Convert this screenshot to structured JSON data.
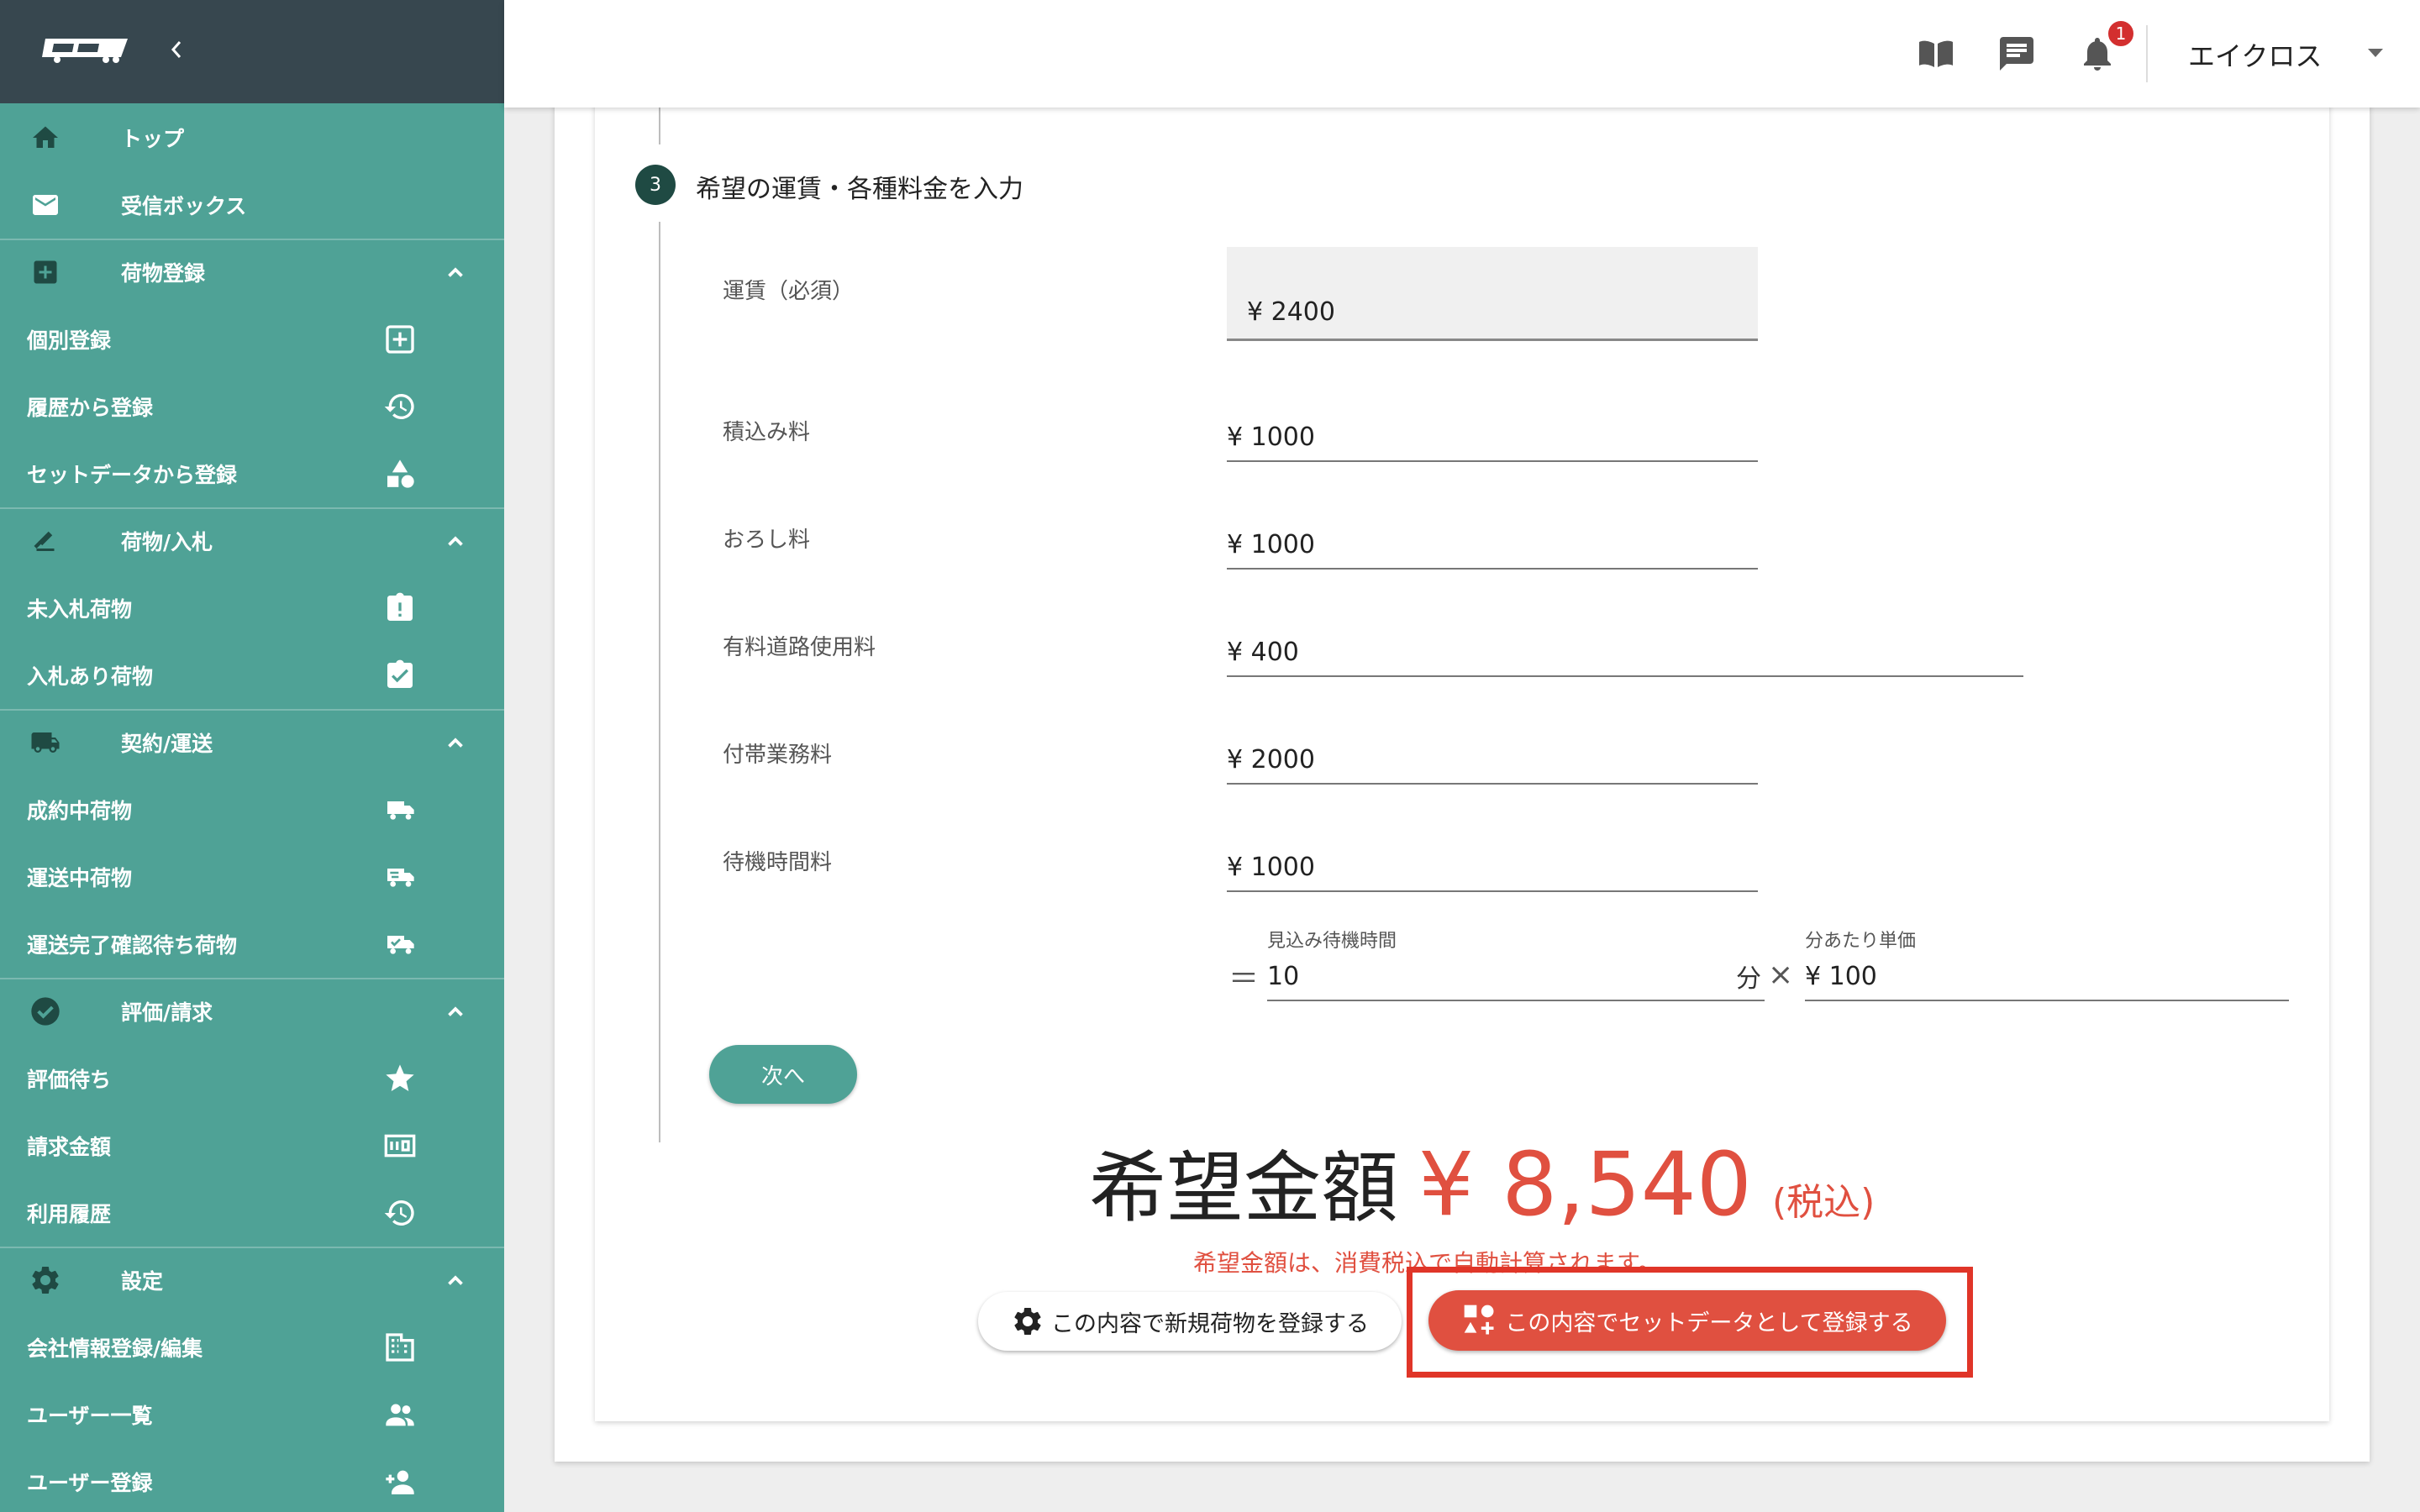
{
  "sidebar": {
    "items": [
      {
        "label": "トップ",
        "icon": "home-icon"
      },
      {
        "label": "受信ボックス",
        "icon": "mail-icon"
      },
      {
        "label": "荷物登録",
        "icon": "add-box-icon"
      },
      {
        "label": "個別登録",
        "icon": "add-square-icon"
      },
      {
        "label": "履歴から登録",
        "icon": "history-icon"
      },
      {
        "label": "セットデータから登録",
        "icon": "shapes-icon"
      },
      {
        "label": "荷物/入札",
        "icon": "bid-icon"
      },
      {
        "label": "未入札荷物",
        "icon": "clipboard-alert-icon"
      },
      {
        "label": "入札あり荷物",
        "icon": "clipboard-check-icon"
      },
      {
        "label": "契約/運送",
        "icon": "truck-icon"
      },
      {
        "label": "成約中荷物",
        "icon": "truck-icon"
      },
      {
        "label": "運送中荷物",
        "icon": "truck-fast-icon"
      },
      {
        "label": "運送完了確認待ち荷物",
        "icon": "truck-check-icon"
      },
      {
        "label": "評価/請求",
        "icon": "check-circle-icon"
      },
      {
        "label": "評価待ち",
        "icon": "star-icon"
      },
      {
        "label": "請求金額",
        "icon": "money-icon"
      },
      {
        "label": "利用履歴",
        "icon": "history-icon"
      },
      {
        "label": "設定",
        "icon": "gear-icon"
      },
      {
        "label": "会社情報登録/編集",
        "icon": "building-icon"
      },
      {
        "label": "ユーザー一覧",
        "icon": "people-icon"
      },
      {
        "label": "ユーザー登録",
        "icon": "person-add-icon"
      }
    ]
  },
  "topbar": {
    "notification_count": "1",
    "user_name": "エイクロス"
  },
  "step": {
    "number": "3",
    "title": "希望の運賃・各種料金を入力"
  },
  "fields": {
    "fare_label": "運賃（必須）",
    "fare_value": "¥ 2400",
    "loading_label": "積込み料",
    "loading_value": "¥ 1000",
    "unloading_label": "おろし料",
    "unloading_value": "¥ 1000",
    "toll_label": "有料道路使用料",
    "toll_value": "¥ 400",
    "extra_label": "付帯業務料",
    "extra_value": "¥ 2000",
    "waiting_label": "待機時間料",
    "waiting_value": "¥ 1000",
    "est_wait_label": "見込み待機時間",
    "est_wait_value": "10",
    "est_wait_unit": "分",
    "per_min_label": "分あたり単価",
    "per_min_value": "¥ 100",
    "equals": "＝",
    "times": "×"
  },
  "next_label": "次へ",
  "total": {
    "lead": "希望金額",
    "amount": "¥ 8,540",
    "tax": "(税込)",
    "note": "希望金額は、消費税込で自動計算されます。"
  },
  "buttons": {
    "register_new": "この内容で新規荷物を登録する",
    "register_set": "この内容でセットデータとして登録する"
  },
  "colors": {
    "sidebar": "#4fa296",
    "sidebar_header": "#37474f",
    "accent_red": "#e05040",
    "highlight": "#e03528"
  }
}
